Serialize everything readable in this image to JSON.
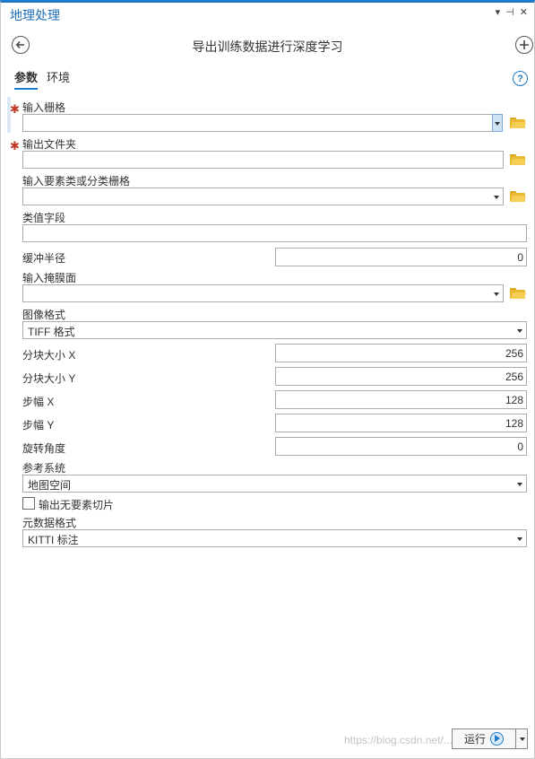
{
  "app_title": "地理处理",
  "window_controls": {
    "menu": "▾",
    "pin": "⊣",
    "close": "✕"
  },
  "tool_title": "导出训练数据进行深度学习",
  "tabs": [
    {
      "label": "参数"
    },
    {
      "label": "环境"
    }
  ],
  "help": "?",
  "params": {
    "input_raster": {
      "label": "输入栅格",
      "value": ""
    },
    "output_folder": {
      "label": "输出文件夹",
      "value": ""
    },
    "input_features": {
      "label": "输入要素类或分类栅格",
      "value": ""
    },
    "class_value_field": {
      "label": "类值字段",
      "value": ""
    },
    "buffer_radius": {
      "label": "缓冲半径",
      "value": "0"
    },
    "input_mask": {
      "label": "输入掩膜面",
      "value": ""
    },
    "image_format": {
      "label": "图像格式",
      "value": "TIFF 格式"
    },
    "tile_size_x": {
      "label": "分块大小 X",
      "value": "256"
    },
    "tile_size_y": {
      "label": "分块大小 Y",
      "value": "256"
    },
    "stride_x": {
      "label": "步幅 X",
      "value": "128"
    },
    "stride_y": {
      "label": "步幅 Y",
      "value": "128"
    },
    "rotation_angle": {
      "label": "旋转角度",
      "value": "0"
    },
    "reference_system": {
      "label": "参考系统",
      "value": "地图空间"
    },
    "output_no_feature_tiles": {
      "label": "输出无要素切片",
      "checked": false
    },
    "metadata_format": {
      "label": "元数据格式",
      "value": "KITTI 标注"
    }
  },
  "run_button": {
    "label": "运行"
  },
  "watermark": "https://blog.csdn.net/..."
}
